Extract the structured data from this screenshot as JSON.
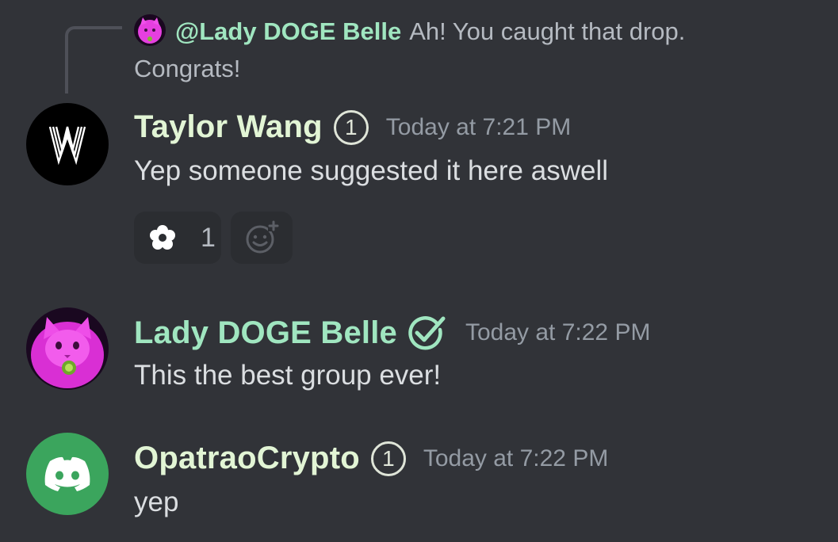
{
  "reply": {
    "mention": "@Lady DOGE Belle",
    "text": "Ah!  You caught that drop. Congrats!"
  },
  "messages": [
    {
      "username": "Taylor Wang",
      "username_color": "#e2f5d5",
      "badge": "1",
      "timestamp": "Today at 7:21 PM",
      "body": "Yep someone suggested it here aswell",
      "avatar_icon": "w-logo-icon",
      "reactions": [
        {
          "icon": "flower-icon",
          "count": "1"
        }
      ]
    },
    {
      "username": "Lady DOGE Belle",
      "username_color": "#a0e6c0",
      "badge_icon": "verified-check-icon",
      "timestamp": "Today at 7:22 PM",
      "body": "This the best group ever!",
      "avatar_icon": "pink-cat-avatar"
    },
    {
      "username": "OpatraoCrypto",
      "username_color": "#e2f5d5",
      "badge": "1",
      "timestamp": "Today at 7:22 PM",
      "body": "yep",
      "avatar_icon": "discord-logo-icon"
    }
  ],
  "colors": {
    "background": "#313338",
    "reaction_bg": "#2b2d31",
    "timestamp": "#949ba4",
    "discord_green": "#3ba55d"
  }
}
